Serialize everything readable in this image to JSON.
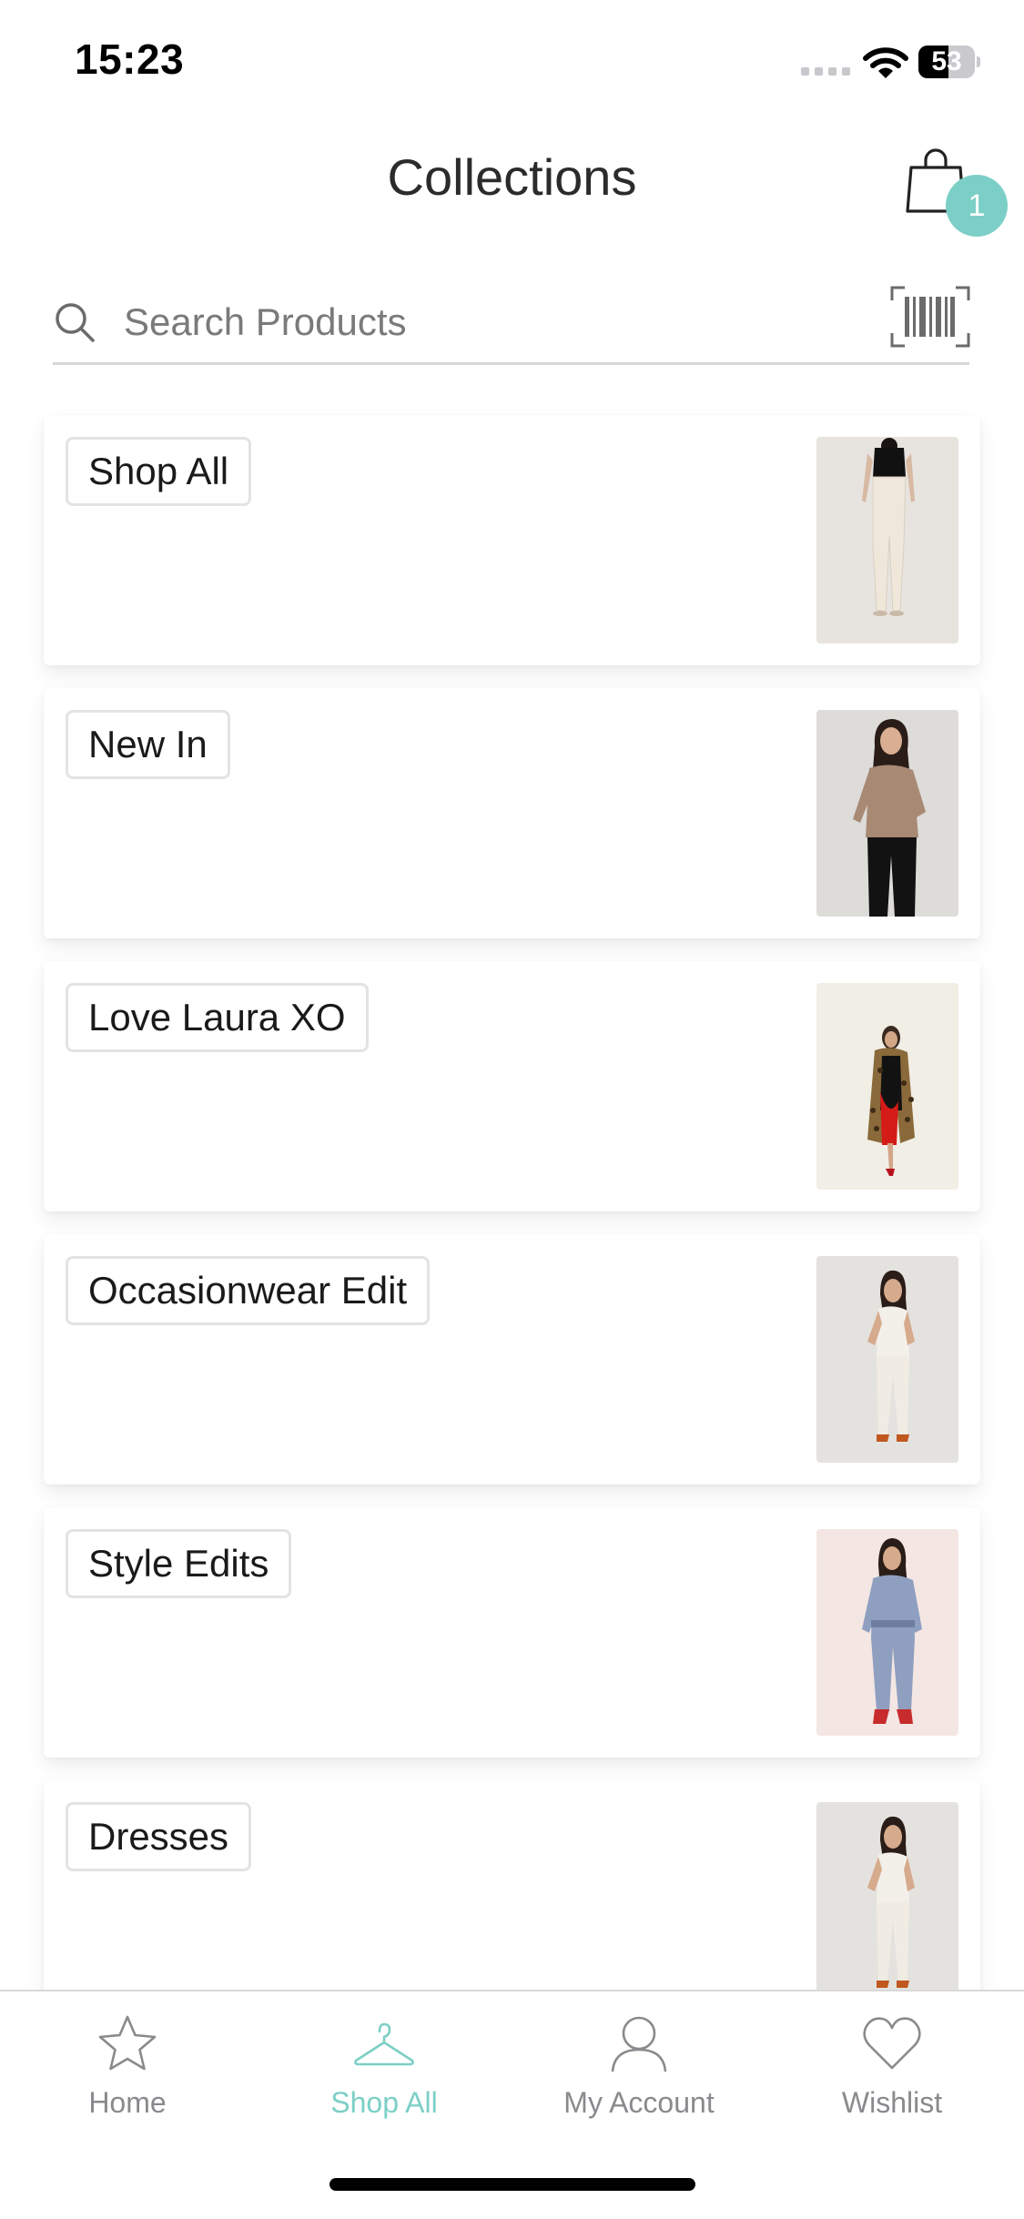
{
  "status_bar": {
    "time": "15:23",
    "battery_level": "53",
    "battery_fraction": 0.53
  },
  "header": {
    "title": "Collections",
    "cart_count": "1",
    "cart_icon": "shopping-bag-icon"
  },
  "search": {
    "placeholder": "Search Products",
    "value": "",
    "icon": "search-icon",
    "barcode_icon": "barcode-scan-icon"
  },
  "collections": [
    {
      "label": "Shop All",
      "image": "model-cream-trousers-photo"
    },
    {
      "label": "New In",
      "image": "model-beige-cardigan-photo"
    },
    {
      "label": "Love Laura XO",
      "image": "model-leopard-coat-photo"
    },
    {
      "label": "Occasionwear Edit",
      "image": "model-white-co-ord-photo"
    },
    {
      "label": "Style Edits",
      "image": "model-denim-jumpsuit-photo"
    },
    {
      "label": "Dresses",
      "image": "model-white-dress-photo"
    }
  ],
  "tab_bar": {
    "items": [
      {
        "label": "Home",
        "icon": "star-icon",
        "active": false
      },
      {
        "label": "Shop All",
        "icon": "hanger-icon",
        "active": true
      },
      {
        "label": "My Account",
        "icon": "person-icon",
        "active": false
      },
      {
        "label": "Wishlist",
        "icon": "heart-icon",
        "active": false
      }
    ]
  },
  "colors": {
    "accent": "#7ccfc6",
    "text": "#1c1c1e",
    "muted": "#8a8a8e",
    "card_border": "#e3e3e3"
  }
}
